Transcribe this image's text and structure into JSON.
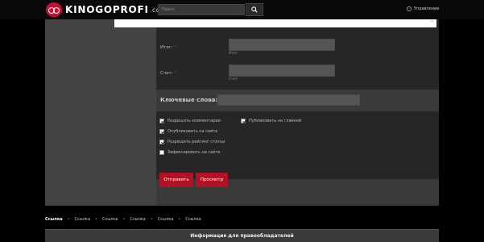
{
  "header": {
    "logo_text": "KINOGOPROFI",
    "logo_tld": ".COM",
    "search_placeholder": "Поиск",
    "manage_label": "Управление"
  },
  "form": {
    "total_label": "Итог:",
    "total_hint": "Итог",
    "account_label": "Счет:",
    "account_hint": "Счет",
    "keywords_label": "Ключевые слова:",
    "required_mark": "*",
    "checkboxes": [
      {
        "label": "Разрешить комментарии",
        "checked": true
      },
      {
        "label": "Опубликовать на сайте",
        "checked": true
      },
      {
        "label": "Разрешить рейтинг статьи",
        "checked": true
      },
      {
        "label": "Зафиксировать на сайте",
        "checked": false
      },
      {
        "label": "Публиковать на главной",
        "checked": true
      }
    ],
    "submit_label": "Отправить",
    "preview_label": "Просмотр"
  },
  "footer": {
    "links": [
      "Ссылка",
      "Ссылка",
      "Ссылка",
      "Ссылка",
      "Ссылка",
      "Ссылка"
    ],
    "separator": "•",
    "rights_title": "Информация для правообладателей"
  },
  "colors": {
    "accent": "#b11226",
    "logo_red": "#c8102e"
  },
  "icons": {
    "search": "search-icon",
    "gear": "gear-icon",
    "logo": "glasses-logo-icon"
  }
}
